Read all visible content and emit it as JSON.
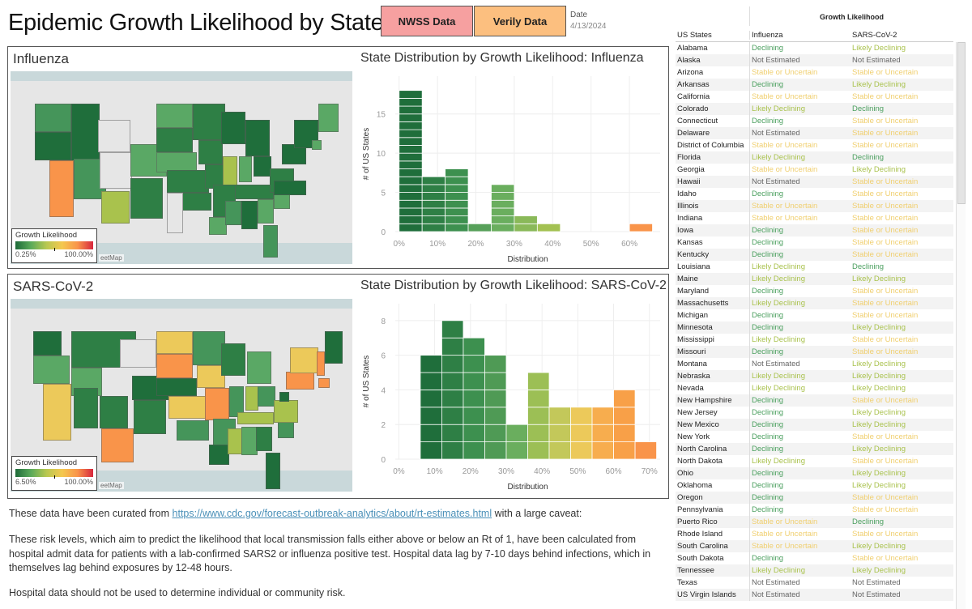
{
  "header": {
    "title": "Epidemic Growth Likelihood by State",
    "nwss_button": "NWSS Data",
    "verily_button": "Verily Data",
    "date_label": "Date",
    "date_value": "4/13/2024"
  },
  "colors": {
    "declining": "#4a9f5e",
    "likely_declining": "#a9c24d",
    "stable": "#f0cf6f",
    "not_estimated": "#666666",
    "nwss_bg": "#f6a0a0",
    "verily_bg": "#fcbf7f"
  },
  "influenza": {
    "panel_title": "Influenza",
    "chart_title": "State Distribution by Growth Likelihood: Influenza",
    "legend": {
      "title": "Growth Likelihood",
      "min": "0.25%",
      "max": "100.00%"
    },
    "map_attribution": "eetMap"
  },
  "sars": {
    "panel_title": "SARS-CoV-2",
    "chart_title": "State Distribution by Growth Likelihood: SARS-CoV-2",
    "legend": {
      "title": "Growth Likelihood",
      "min": "6.50%",
      "max": "100.00%"
    },
    "map_attribution": "eetMap"
  },
  "chart_data": [
    {
      "type": "bar",
      "title": "State Distribution by Growth Likelihood: Influenza",
      "xlabel": "Distribution",
      "ylabel": "# of US States",
      "bin_start": [
        0,
        6,
        12,
        18,
        24,
        30,
        36,
        42,
        48,
        54,
        60
      ],
      "bin_width": 6,
      "values": [
        18,
        7,
        8,
        1,
        6,
        2,
        1,
        0,
        0,
        0,
        1
      ],
      "colors": [
        "#1f6e3b",
        "#2e7f45",
        "#3d904f",
        "#57a05a",
        "#6aae5e",
        "#8ab959",
        "#a3c152",
        "#b8c64f",
        "#e0c850",
        "#f4b04a",
        "#f9944a"
      ],
      "xticks": [
        "0%",
        "10%",
        "20%",
        "30%",
        "40%",
        "50%",
        "60%"
      ],
      "xtick_values": [
        0,
        10,
        20,
        30,
        40,
        50,
        60
      ],
      "yticks": [
        0,
        5,
        10,
        15
      ],
      "xlim": [
        -1,
        68
      ],
      "ylim": [
        0,
        19
      ]
    },
    {
      "type": "bar",
      "title": "State Distribution by Growth Likelihood: SARS-CoV-2",
      "xlabel": "Distribution",
      "ylabel": "# of US States",
      "bin_start": [
        6,
        12,
        18,
        24,
        30,
        36,
        42,
        48,
        54,
        60,
        66
      ],
      "bin_width": 6,
      "values": [
        6,
        8,
        7,
        6,
        2,
        5,
        3,
        3,
        3,
        4,
        1
      ],
      "colors": [
        "#1f6e3b",
        "#2e7f45",
        "#3d904f",
        "#4f9a55",
        "#6aae5e",
        "#9cbf55",
        "#c3c85a",
        "#ecc95a",
        "#f7ad4e",
        "#f8a048",
        "#f9944a"
      ],
      "xticks": [
        "0%",
        "10%",
        "20%",
        "30%",
        "40%",
        "50%",
        "60%",
        "70%"
      ],
      "xtick_values": [
        0,
        10,
        20,
        30,
        40,
        50,
        60,
        70
      ],
      "yticks": [
        0,
        2,
        4,
        6,
        8
      ],
      "xlim": [
        -1,
        73
      ],
      "ylim": [
        0,
        8.6
      ]
    }
  ],
  "table": {
    "group_header": "Growth Likelihood",
    "columns": [
      "US States",
      "Influenza",
      "SARS-CoV-2"
    ],
    "rows": [
      [
        "Alabama",
        "Declining",
        "Likely Declining"
      ],
      [
        "Alaska",
        "Not Estimated",
        "Not Estimated"
      ],
      [
        "Arizona",
        "Stable or Uncertain",
        "Stable or Uncertain"
      ],
      [
        "Arkansas",
        "Declining",
        "Likely Declining"
      ],
      [
        "California",
        "Stable or Uncertain",
        "Stable or Uncertain"
      ],
      [
        "Colorado",
        "Likely Declining",
        "Declining"
      ],
      [
        "Connecticut",
        "Declining",
        "Stable or Uncertain"
      ],
      [
        "Delaware",
        "Not Estimated",
        "Stable or Uncertain"
      ],
      [
        "District of Columbia",
        "Stable or Uncertain",
        "Stable or Uncertain"
      ],
      [
        "Florida",
        "Likely Declining",
        "Declining"
      ],
      [
        "Georgia",
        "Stable or Uncertain",
        "Likely Declining"
      ],
      [
        "Hawaii",
        "Not Estimated",
        "Stable or Uncertain"
      ],
      [
        "Idaho",
        "Declining",
        "Stable or Uncertain"
      ],
      [
        "Illinois",
        "Stable or Uncertain",
        "Stable or Uncertain"
      ],
      [
        "Indiana",
        "Stable or Uncertain",
        "Stable or Uncertain"
      ],
      [
        "Iowa",
        "Declining",
        "Stable or Uncertain"
      ],
      [
        "Kansas",
        "Declining",
        "Stable or Uncertain"
      ],
      [
        "Kentucky",
        "Declining",
        "Stable or Uncertain"
      ],
      [
        "Louisiana",
        "Likely Declining",
        "Declining"
      ],
      [
        "Maine",
        "Likely Declining",
        "Likely Declining"
      ],
      [
        "Maryland",
        "Declining",
        "Stable or Uncertain"
      ],
      [
        "Massachusetts",
        "Likely Declining",
        "Stable or Uncertain"
      ],
      [
        "Michigan",
        "Declining",
        "Stable or Uncertain"
      ],
      [
        "Minnesota",
        "Declining",
        "Likely Declining"
      ],
      [
        "Mississippi",
        "Likely Declining",
        "Stable or Uncertain"
      ],
      [
        "Missouri",
        "Declining",
        "Stable or Uncertain"
      ],
      [
        "Montana",
        "Not Estimated",
        "Likely Declining"
      ],
      [
        "Nebraska",
        "Likely Declining",
        "Likely Declining"
      ],
      [
        "Nevada",
        "Likely Declining",
        "Likely Declining"
      ],
      [
        "New Hampshire",
        "Declining",
        "Stable or Uncertain"
      ],
      [
        "New Jersey",
        "Declining",
        "Likely Declining"
      ],
      [
        "New Mexico",
        "Declining",
        "Likely Declining"
      ],
      [
        "New York",
        "Declining",
        "Stable or Uncertain"
      ],
      [
        "North Carolina",
        "Declining",
        "Likely Declining"
      ],
      [
        "North Dakota",
        "Likely Declining",
        "Stable or Uncertain"
      ],
      [
        "Ohio",
        "Declining",
        "Likely Declining"
      ],
      [
        "Oklahoma",
        "Declining",
        "Likely Declining"
      ],
      [
        "Oregon",
        "Declining",
        "Stable or Uncertain"
      ],
      [
        "Pennsylvania",
        "Declining",
        "Stable or Uncertain"
      ],
      [
        "Puerto Rico",
        "Stable or Uncertain",
        "Declining"
      ],
      [
        "Rhode Island",
        "Stable or Uncertain",
        "Stable or Uncertain"
      ],
      [
        "South Carolina",
        "Stable or Uncertain",
        "Likely Declining"
      ],
      [
        "South Dakota",
        "Declining",
        "Stable or Uncertain"
      ],
      [
        "Tennessee",
        "Likely Declining",
        "Likely Declining"
      ],
      [
        "Texas",
        "Not Estimated",
        "Not Estimated"
      ],
      [
        "US Virgin Islands",
        "Not Estimated",
        "Not Estimated"
      ]
    ]
  },
  "notes": {
    "line1_prefix": "These data have been curated from ",
    "line1_link": "https://www.cdc.gov/forecast-outbreak-analytics/about/rt-estimates.html",
    "line1_suffix": " with a large caveat:",
    "paragraph2": "These risk levels, which aim to predict the likelihood that local transmission falls either above or below an Rt of 1, have been calculated from hospital admit data for patients with a lab-confirmed SARS2 or influenza positive test. Hospital data lag by 7-10 days behind infections, which in themselves lag behind exposures by 12-48 hours.",
    "paragraph3": "Hospital data should not be used to determine individual or community risk."
  }
}
